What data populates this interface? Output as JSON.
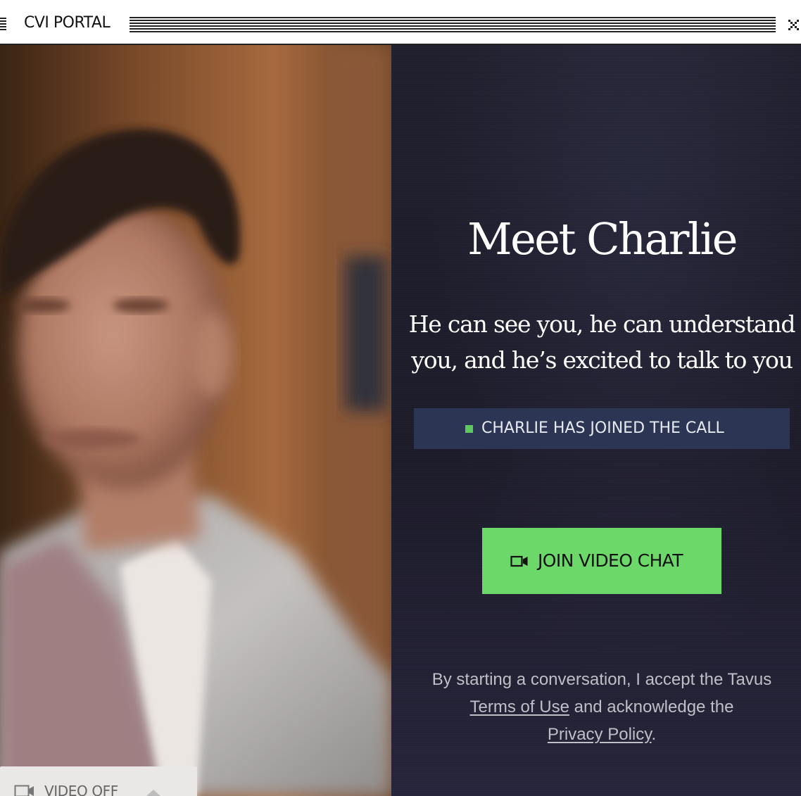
{
  "window": {
    "title": "CVI PORTAL",
    "close_icon": "close-icon"
  },
  "video": {
    "toggle_label": "VIDEO OFF",
    "camera_icon": "video-camera-icon",
    "caret_icon": "caret-up-icon"
  },
  "info": {
    "heading": "Meet Charlie",
    "subheading": "He can see you, he can understand you, and he’s excited to talk to you",
    "status_text": "CHARLIE HAS JOINED THE CALL",
    "status_color": "#5dca60",
    "join_button_label": "JOIN VIDEO CHAT",
    "join_button_color": "#6cd86a",
    "legal": {
      "prefix": "By starting a conversation, I accept the Tavus",
      "terms_link": "Terms of Use",
      "middle": "and acknowledge the",
      "privacy_link": "Privacy Policy",
      "suffix": "."
    }
  }
}
